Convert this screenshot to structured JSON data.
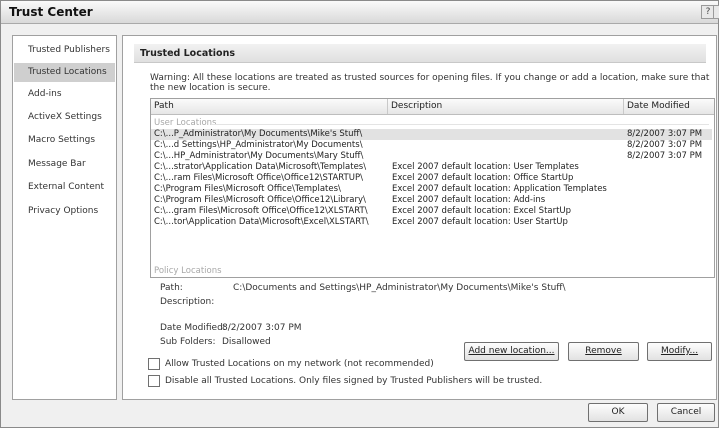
{
  "window": {
    "title": "Trust Center",
    "help_glyph": "?",
    "close_glyph": "x"
  },
  "sidebar": {
    "items": [
      {
        "label": "Trusted Publishers"
      },
      {
        "label": "Trusted Locations"
      },
      {
        "label": "Add-ins"
      },
      {
        "label": "ActiveX Settings"
      },
      {
        "label": "Macro Settings"
      },
      {
        "label": "Message Bar"
      },
      {
        "label": "External Content"
      },
      {
        "label": "Privacy Options"
      }
    ],
    "selected": "Trusted Locations"
  },
  "main": {
    "section_title": "Trusted Locations",
    "warning": "Warning: All these locations are treated as trusted sources for opening files. If you change or add a location, make sure that the new location is secure.",
    "table": {
      "columns": [
        "Path",
        "Description",
        "Date Modified"
      ],
      "user_group_label": "User Locations",
      "policy_group_label": "Policy Locations",
      "rows": [
        {
          "path": "C:\\...P_Administrator\\My Documents\\Mike's Stuff\\",
          "description": "",
          "date": "8/2/2007 3:07 PM"
        },
        {
          "path": "C:\\...d Settings\\HP_Administrator\\My Documents\\",
          "description": "",
          "date": "8/2/2007 3:07 PM"
        },
        {
          "path": "C:\\...HP_Administrator\\My Documents\\Mary Stuff\\",
          "description": "",
          "date": "8/2/2007 3:07 PM"
        },
        {
          "path": "C:\\...strator\\Application Data\\Microsoft\\Templates\\",
          "description": "Excel 2007 default location: User Templates",
          "date": ""
        },
        {
          "path": "C:\\...ram Files\\Microsoft Office\\Office12\\STARTUP\\",
          "description": "Excel 2007 default location: Office StartUp",
          "date": ""
        },
        {
          "path": "C:\\Program Files\\Microsoft Office\\Templates\\",
          "description": "Excel 2007 default location: Application Templates",
          "date": ""
        },
        {
          "path": "C:\\Program Files\\Microsoft Office\\Office12\\Library\\",
          "description": "Excel 2007 default location: Add-ins",
          "date": ""
        },
        {
          "path": "C:\\...gram Files\\Microsoft Office\\Office12\\XLSTART\\",
          "description": "Excel 2007 default location: Excel StartUp",
          "date": ""
        },
        {
          "path": "C:\\...tor\\Application Data\\Microsoft\\Excel\\XLSTART\\",
          "description": "Excel 2007 default location: User StartUp",
          "date": ""
        }
      ]
    },
    "details": {
      "path_label": "Path:",
      "path_value": "C:\\Documents and Settings\\HP_Administrator\\My Documents\\Mike's Stuff\\",
      "description_label": "Description:",
      "date_label": "Date Modified:",
      "date_value": "8/2/2007 3:07 PM",
      "subfolders_label": "Sub Folders:",
      "subfolders_value": "Disallowed"
    },
    "buttons": {
      "add": "Add new location...",
      "remove": "Remove",
      "modify": "Modify..."
    },
    "checkboxes": {
      "allow_network": "Allow Trusted Locations on my network (not recommended)",
      "disable_all": "Disable all Trusted Locations. Only files signed by Trusted Publishers will be trusted."
    }
  },
  "footer": {
    "ok": "OK",
    "cancel": "Cancel"
  }
}
